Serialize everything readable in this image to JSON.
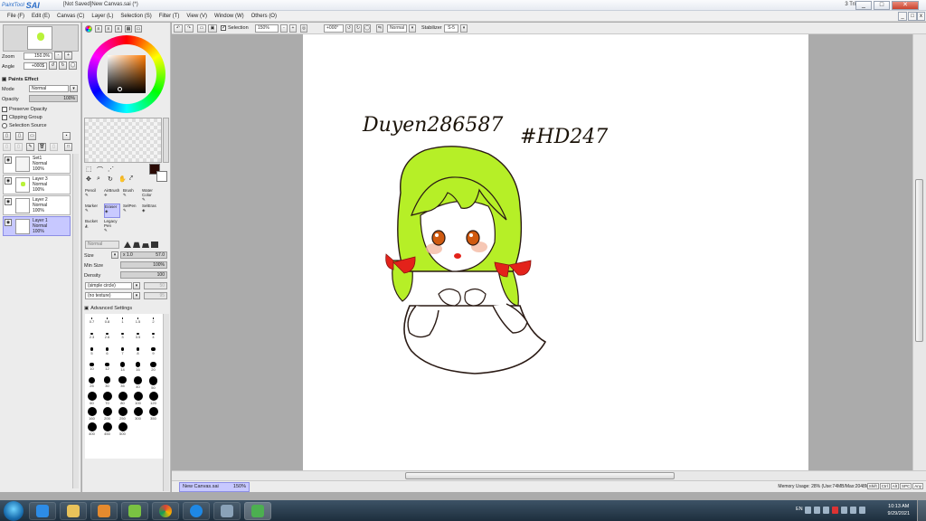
{
  "app": {
    "logo_small": "PaintTool",
    "logo_big": "SAI",
    "title": "[Not Saved]New Canvas.sai (*)",
    "trial": "3 Trial day",
    "window_buttons": [
      "_",
      "□",
      "✕"
    ]
  },
  "menu": [
    "File (F)",
    "Edit (E)",
    "Canvas (C)",
    "Layer (L)",
    "Selection (S)",
    "Filter (T)",
    "View (V)",
    "Window (W)",
    "Others (O)"
  ],
  "toolbar": {
    "selection_label": "Selection",
    "zoom_value": "150%",
    "angle_value": "+000°",
    "blend_value": "Normal",
    "stabilizer_label": "Stabilizer",
    "stabilizer_value": "S-5"
  },
  "navigator": {
    "zoom_label": "Zoom",
    "zoom_value": "150.0%",
    "angle_label": "Angle",
    "angle_value": "+000$"
  },
  "paint_effect": {
    "title": "Paints Effect",
    "mode_label": "Mode",
    "mode_value": "Normal",
    "opacity_label": "Opacity",
    "opacity_value": "100%",
    "preserve_opacity": "Preserve Opacity",
    "clipping_group": "Clipping Group",
    "selection_source": "Selection Source"
  },
  "layers": [
    {
      "name": "Set1",
      "mode": "Normal",
      "opacity": "100%",
      "selected": false
    },
    {
      "name": "Layer 3",
      "mode": "Normal",
      "opacity": "100%",
      "selected": false
    },
    {
      "name": "Layer 2",
      "mode": "Normal",
      "opacity": "100%",
      "selected": false
    },
    {
      "name": "Layer 1",
      "mode": "Normal",
      "opacity": "100%",
      "selected": true
    }
  ],
  "tools": {
    "row1": [
      "Pencil",
      "AirBrush",
      "Brush",
      "Water Color"
    ],
    "row2": [
      "Marker",
      "Eraser",
      "SelPen",
      "SelEras"
    ],
    "row3": [
      "Bucket",
      "Legacy Pen"
    ],
    "blend_label": "Normal",
    "size_label": "Size",
    "size_mult": "x 1.0",
    "size_value": "57.0",
    "min_size_label": "Min Size",
    "min_size_value": "100%",
    "density_label": "Density",
    "density_value": "100",
    "shape_value": "(simple circle)",
    "shape_num": "50",
    "texture_value": "(no texture)",
    "texture_num": "95",
    "advanced": "Advanced Settings"
  },
  "brush_sizes": [
    "0.7",
    "0.8",
    "1",
    "1.5",
    "2",
    "2.3",
    "2.6",
    "3",
    "3.5",
    "4",
    "5",
    "6",
    "7",
    "8",
    "9",
    "10",
    "12",
    "14",
    "16",
    "20",
    "25",
    "30",
    "35",
    "40",
    "50",
    "60",
    "70",
    "80",
    "100",
    "120",
    "160",
    "200",
    "250",
    "300",
    "350",
    "400",
    "450",
    "500"
  ],
  "canvas": {
    "signature_text": "Duyen286587",
    "hashtag_text": "#HD247"
  },
  "status": {
    "doc_tab": "New Canvas.sai",
    "doc_zoom": "150%",
    "memory": "Memory Usage: 28% (Use:74MB/Max:2048MB)",
    "status_buttons": [
      "Shift",
      "Ctrl",
      "Alt",
      "SPC",
      "Any"
    ]
  },
  "taskbar": {
    "time": "10:13 AM",
    "date": "9/29/2021",
    "lang": "EN"
  }
}
